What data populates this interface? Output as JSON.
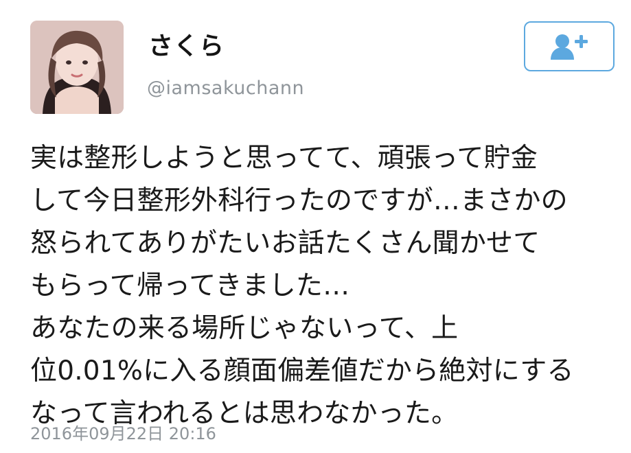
{
  "profile": {
    "display_name": "さくら",
    "handle": "@iamsakuchann",
    "avatar_icon": "profile-photo"
  },
  "follow_button": {
    "icon": "add-user-icon",
    "color": "#5ca8df"
  },
  "tweet": {
    "text": "実は整形しようと思ってて、頑張って貯金\nして今日整形外科行ったのですが…まさかの\n怒られてありがたいお話たくさん聞かせて\nもらって帰ってきました…\nあなたの来る場所じゃないって、上\n位0.01%に入る顔面偏差値だから絶対にする\nなって言われるとは思わなかった。",
    "timestamp": "2016年09月22日 20:16"
  }
}
